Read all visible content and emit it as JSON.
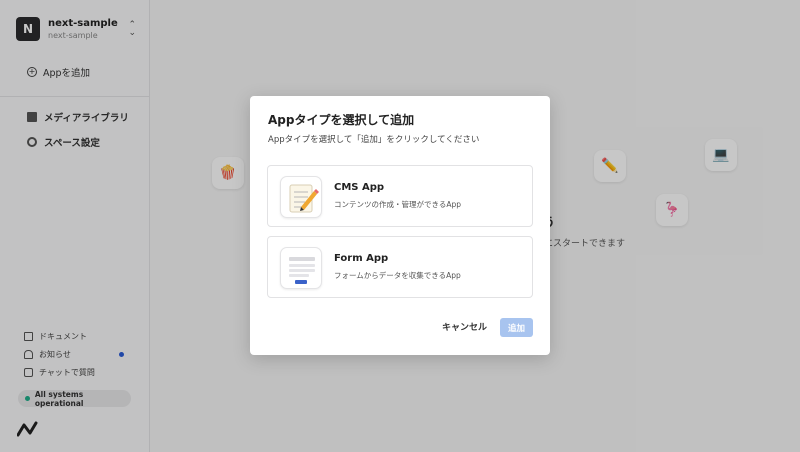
{
  "workspace": {
    "initial": "N",
    "name": "next-sample",
    "subtitle": "next-sample"
  },
  "sidebar": {
    "add_app": "Appを追加",
    "items": [
      {
        "label": "メディアライブラリ",
        "icon": "image-icon"
      },
      {
        "label": "スペース設定",
        "icon": "gear-icon"
      }
    ],
    "bottom": [
      {
        "label": "ドキュメント",
        "icon": "book-icon"
      },
      {
        "label": "お知らせ",
        "icon": "bell-icon"
      },
      {
        "label": "チャットで質問",
        "icon": "chat-icon"
      }
    ],
    "status": "All systems operational"
  },
  "background": {
    "heading_partial": "う",
    "text_partial": "にスタートできます"
  },
  "modal": {
    "title": "Appタイプを選択して追加",
    "description": "Appタイプを選択して「追加」をクリックしてください",
    "options": [
      {
        "title": "CMS App",
        "description": "コンテンツの作成・管理ができるApp",
        "icon": "pencil-notepad-icon"
      },
      {
        "title": "Form App",
        "description": "フォームからデータを収集できるApp",
        "icon": "form-icon"
      }
    ],
    "cancel_label": "キャンセル",
    "add_label": "追加"
  },
  "colors": {
    "accent_disabled": "#a8c4ef",
    "status_green": "#1fae8a",
    "notification_blue": "#2a5bd7"
  }
}
